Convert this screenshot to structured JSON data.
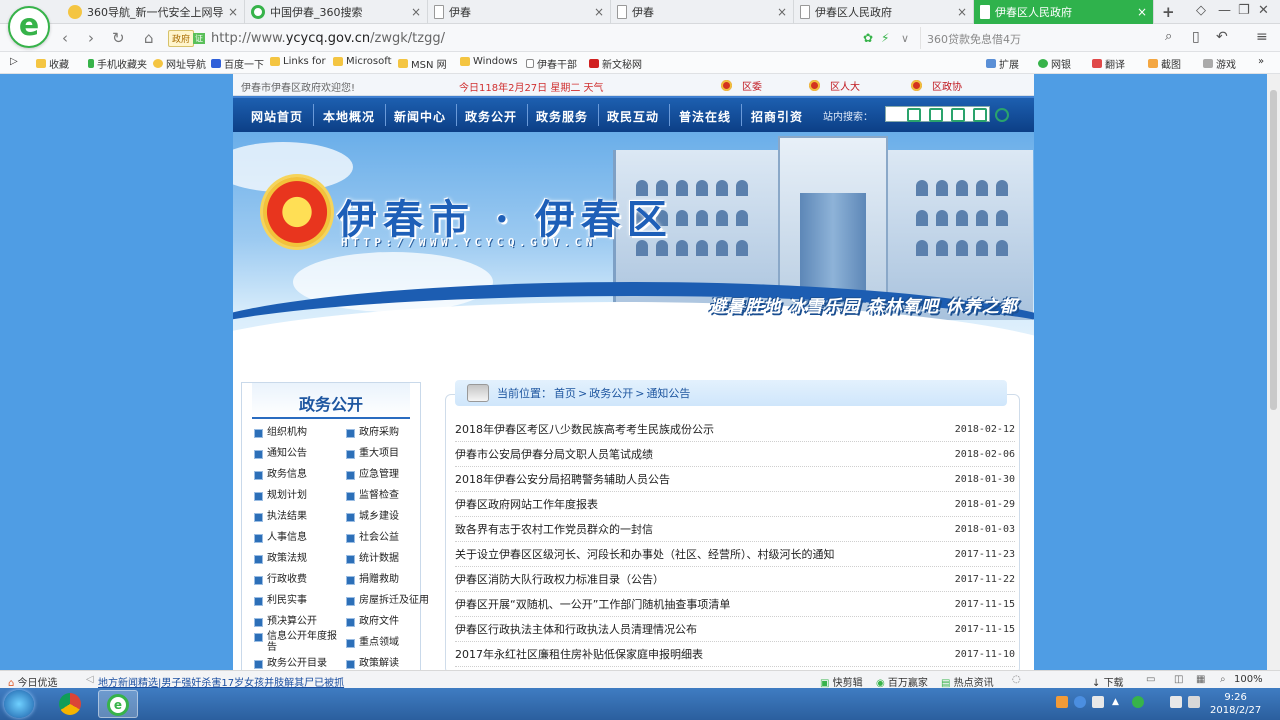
{
  "browser": {
    "logo": "e",
    "tabs": [
      {
        "title": "360导航_新一代安全上网导航",
        "icon_color": "#f4c542"
      },
      {
        "title": "中国伊春_360搜索",
        "icon_color": "#37b34a"
      },
      {
        "title": "伊春",
        "icon_color": "#bbbbbb"
      },
      {
        "title": "伊春",
        "icon_color": "#bbbbbb"
      },
      {
        "title": "伊春区人民政府",
        "icon_color": "#bbbbbb"
      },
      {
        "title": "伊春区人民政府",
        "icon_color": "#ffffff"
      }
    ],
    "close_glyph": "×",
    "new_tab_glyph": "+",
    "address": {
      "badge": "政府",
      "badge2": "证",
      "prefix": "http://www.",
      "domain": "ycycq.gov.cn",
      "path": "/zwgk/tzgg/"
    },
    "search_placeholder": "360贷款免息借4万",
    "favorites": [
      "收藏",
      "手机收藏夹",
      "网址导航",
      "百度一下",
      "Links for",
      "Microsoft",
      "MSN 网",
      "Windows",
      "伊春干部",
      "新文秘网"
    ],
    "fav_right": [
      "扩展",
      "网银",
      "翻译",
      "截图",
      "游戏"
    ]
  },
  "site": {
    "welcome": "伊春市伊春区政府欢迎您!",
    "date_line": "今日118年2月27日 星期二 天气",
    "gov_links": [
      "区委",
      "区人大",
      "区政协"
    ],
    "menu": [
      "网站首页",
      "本地概况",
      "新闻中心",
      "政务公开",
      "政务服务",
      "政民互动",
      "普法在线",
      "招商引资"
    ],
    "search_label": "站内搜索：",
    "banner": {
      "title": "伊春市 · 伊春区",
      "url": "HTTP://WWW.YCYCQ.GOV.CN",
      "slogan": "避暑胜地 冰雪乐园 森林氧吧 休养之都"
    },
    "sidebar": {
      "title": "政务公开",
      "items": [
        "组织机构",
        "政府采购",
        "通知公告",
        "重大项目",
        "政务信息",
        "应急管理",
        "规划计划",
        "监督检查",
        "执法结果",
        "城乡建设",
        "人事信息",
        "社会公益",
        "政策法规",
        "统计数据",
        "行政收费",
        "捐赠救助",
        "利民实事",
        "房屋拆迁及征用",
        "预决算公开",
        "政府文件",
        "信息公开年度报告",
        "重点领域",
        "政务公开目录",
        "政策解读"
      ]
    },
    "breadcrumb": {
      "label": "当前位置：",
      "home": "首页",
      "sep": ">",
      "c1": "政务公开",
      "c2": "通知公告"
    },
    "news": [
      {
        "title": "2018年伊春区考区八少数民族高考考生民族成份公示",
        "date": "2018-02-12"
      },
      {
        "title": "伊春市公安局伊春分局文职人员笔试成绩",
        "date": "2018-02-06"
      },
      {
        "title": "2018年伊春公安分局招聘警务辅助人员公告",
        "date": "2018-01-30"
      },
      {
        "title": "伊春区政府网站工作年度报表",
        "date": "2018-01-29"
      },
      {
        "title": "致各界有志于农村工作党员群众的一封信",
        "date": "2018-01-03"
      },
      {
        "title": "关于设立伊春区区级河长、河段长和办事处（社区、经营所）、村级河长的通知",
        "date": "2017-11-23"
      },
      {
        "title": "伊春区消防大队行政权力标准目录（公告）",
        "date": "2017-11-22"
      },
      {
        "title": "伊春区开展“双随机、一公开”工作部门随机抽查事项清单",
        "date": "2017-11-15"
      },
      {
        "title": "伊春区行政执法主体和行政执法人员清理情况公布",
        "date": "2017-11-15"
      },
      {
        "title": "2017年永红社区廉租住房补贴低保家庭申报明细表",
        "date": "2017-11-10"
      }
    ]
  },
  "status": {
    "left1": "今日优选",
    "news": "地方新闻精选|男子强奸杀害17岁女孩并肢解其尸已被抓",
    "r1": "快剪辑",
    "r2": "百万赢家",
    "r3": "热点资讯",
    "r4": "下载",
    "zoom": "100%"
  },
  "taskbar": {
    "time": "9:26",
    "date": "2018/2/27"
  }
}
